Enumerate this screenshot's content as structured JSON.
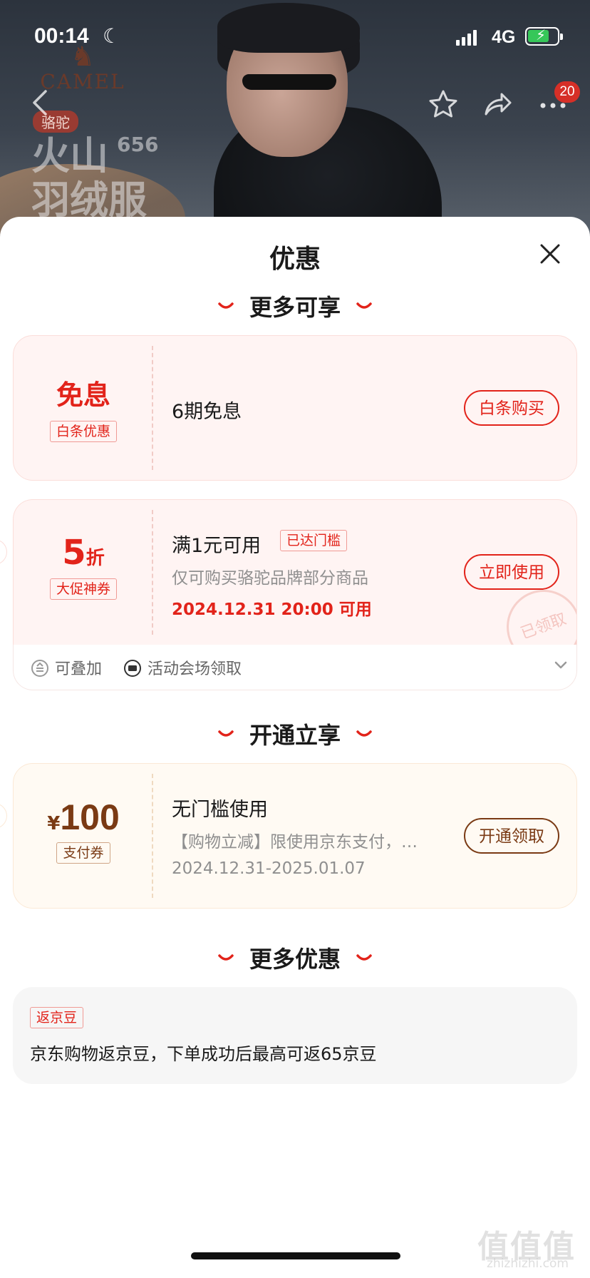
{
  "status_bar": {
    "time": "00:14",
    "network": "4G",
    "battery_percent": 75
  },
  "hero": {
    "brand_logo_text": "CAMEL",
    "brand_chip": "骆驼",
    "promo_title_line1": "火山",
    "promo_title_line2": "羽绒服",
    "promo_number": "656"
  },
  "nav": {
    "badge_count": "20"
  },
  "sheet": {
    "title": "优惠",
    "sections": [
      {
        "heading": "更多可享"
      },
      {
        "heading": "开通立享"
      },
      {
        "heading": "更多优惠"
      }
    ]
  },
  "coupon_interest_free": {
    "value": "免息",
    "tag": "白条优惠",
    "title": "6期免息",
    "button": "白条购买"
  },
  "coupon_discount": {
    "value_num": "5",
    "value_unit": "折",
    "tag": "大促神券",
    "title": "满1元可用",
    "status_tag": "已达门槛",
    "description": "仅可购买骆驼品牌部分商品",
    "valid_time": "2024.12.31 20:00 可用",
    "button": "立即使用",
    "stamp": "已领取",
    "footer": {
      "stackable": "可叠加",
      "source": "活动会场领取"
    }
  },
  "coupon_payment": {
    "currency": "¥",
    "amount": "100",
    "tag": "支付券",
    "title": "无门槛使用",
    "description": "【购物立减】限使用京东支付，…",
    "valid_time": "2024.12.31-2025.01.07",
    "button": "开通领取"
  },
  "jingdou": {
    "tag": "返京豆",
    "text": "京东购物返京豆，下单成功后最高可返65京豆"
  },
  "watermark": {
    "text": "值值值",
    "site": "zhizhizhi.com"
  },
  "colors": {
    "accent_red": "#e2231a",
    "accent_brown": "#7a3a14",
    "battery_green": "#36c759"
  }
}
